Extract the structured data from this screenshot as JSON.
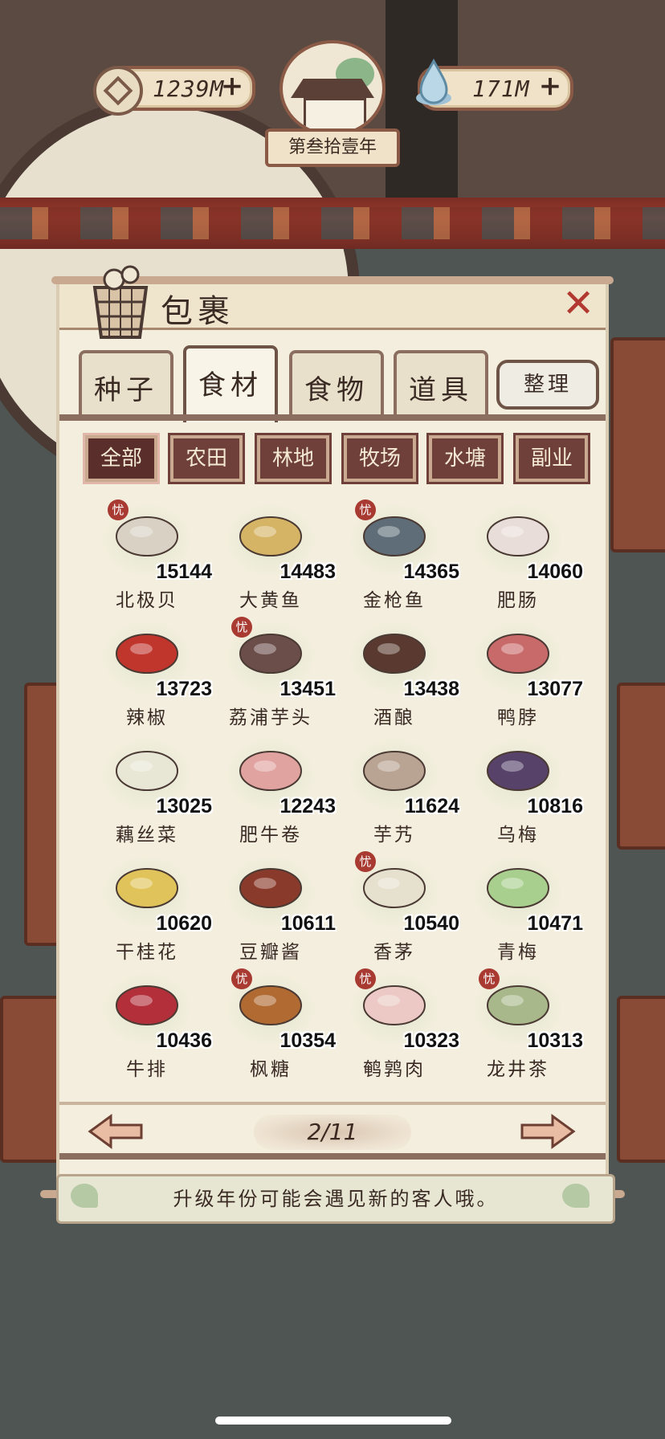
{
  "hud": {
    "coins": "1239M",
    "water": "171M",
    "year": "第叁拾壹年",
    "plus": "+"
  },
  "panel": {
    "title": "包裹",
    "close": "✕"
  },
  "tabs": [
    {
      "label": "种子",
      "active": false
    },
    {
      "label": "食材",
      "active": true
    },
    {
      "label": "食物",
      "active": false
    },
    {
      "label": "道具",
      "active": false
    }
  ],
  "sort_label": "整理",
  "filters": [
    {
      "label": "全部",
      "active": true
    },
    {
      "label": "农田",
      "active": false
    },
    {
      "label": "林地",
      "active": false
    },
    {
      "label": "牧场",
      "active": false
    },
    {
      "label": "水塘",
      "active": false
    },
    {
      "label": "副业",
      "active": false
    }
  ],
  "mark_label": "忧",
  "items": [
    {
      "name": "北极贝",
      "qty": "15144",
      "mark": true,
      "color": "#d9d2c4"
    },
    {
      "name": "大黄鱼",
      "qty": "14483",
      "mark": false,
      "color": "#d6b466"
    },
    {
      "name": "金枪鱼",
      "qty": "14365",
      "mark": true,
      "color": "#5f6d78"
    },
    {
      "name": "肥肠",
      "qty": "14060",
      "mark": false,
      "color": "#e8ddd8"
    },
    {
      "name": "辣椒",
      "qty": "13723",
      "mark": false,
      "color": "#c0352c"
    },
    {
      "name": "荔浦芋头",
      "qty": "13451",
      "mark": true,
      "color": "#6b4e4a"
    },
    {
      "name": "酒酿",
      "qty": "13438",
      "mark": false,
      "color": "#5a3a30"
    },
    {
      "name": "鸭脖",
      "qty": "13077",
      "mark": false,
      "color": "#c96a6a"
    },
    {
      "name": "藕丝菜",
      "qty": "13025",
      "mark": false,
      "color": "#e8e7d6"
    },
    {
      "name": "肥牛卷",
      "qty": "12243",
      "mark": false,
      "color": "#e0a3a0"
    },
    {
      "name": "芋艿",
      "qty": "11624",
      "mark": false,
      "color": "#b9a392"
    },
    {
      "name": "乌梅",
      "qty": "10816",
      "mark": false,
      "color": "#57426a"
    },
    {
      "name": "干桂花",
      "qty": "10620",
      "mark": false,
      "color": "#e0c35a"
    },
    {
      "name": "豆瓣酱",
      "qty": "10611",
      "mark": false,
      "color": "#8a3a2a"
    },
    {
      "name": "香茅",
      "qty": "10540",
      "mark": true,
      "color": "#e6e0ce"
    },
    {
      "name": "青梅",
      "qty": "10471",
      "mark": false,
      "color": "#a9cf8f"
    },
    {
      "name": "牛排",
      "qty": "10436",
      "mark": false,
      "color": "#b3303a"
    },
    {
      "name": "枫糖",
      "qty": "10354",
      "mark": true,
      "color": "#b06a32"
    },
    {
      "name": "鹌鹑肉",
      "qty": "10323",
      "mark": true,
      "color": "#ecc9c4"
    },
    {
      "name": "龙井茶",
      "qty": "10313",
      "mark": true,
      "color": "#a9b88a"
    }
  ],
  "pager": {
    "label": "2/11"
  },
  "tip": "升级年份可能会遇见新的客人哦。"
}
